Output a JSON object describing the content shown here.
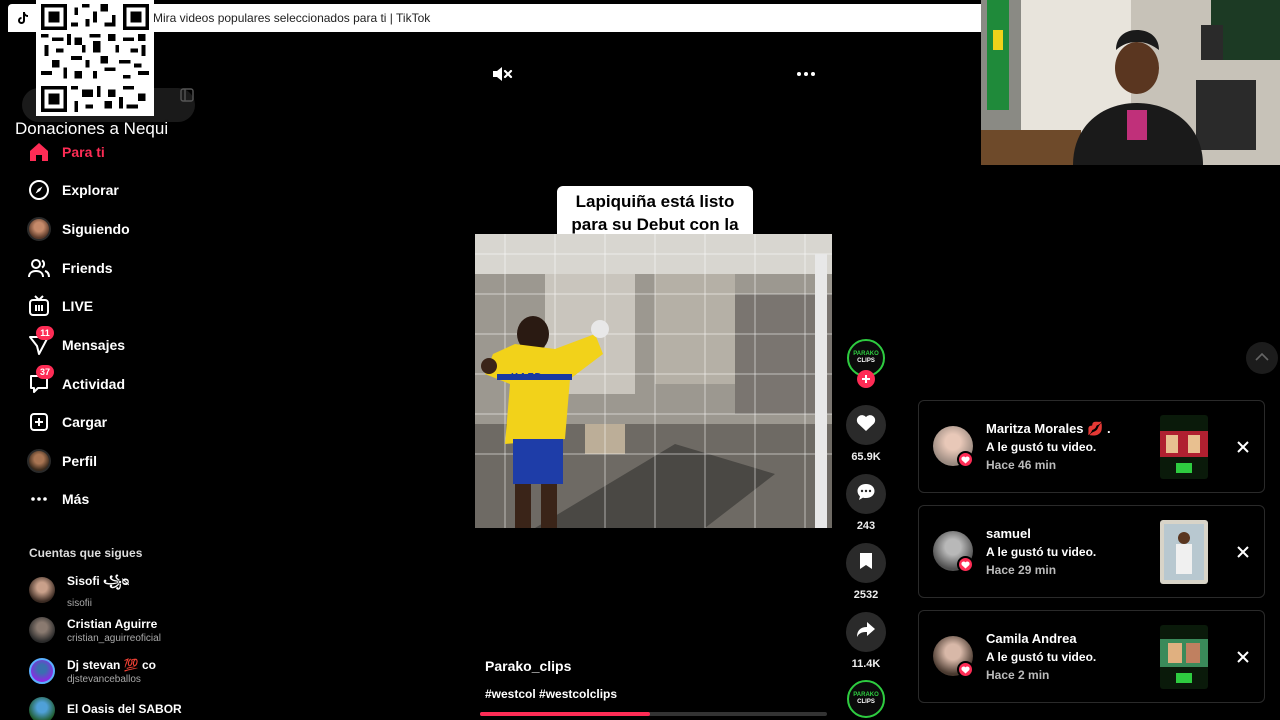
{
  "window": {
    "title": "Mira videos populares seleccionados para ti | TikTok"
  },
  "overlay": {
    "qr_caption": "Donaciones a Nequi"
  },
  "sidebar": {
    "items": [
      {
        "label": "Para ti",
        "icon": "home-icon",
        "active": true
      },
      {
        "label": "Explorar",
        "icon": "compass-icon"
      },
      {
        "label": "Siguiendo",
        "icon": "following-avatar-icon"
      },
      {
        "label": "Friends",
        "icon": "friends-icon"
      },
      {
        "label": "LIVE",
        "icon": "live-icon"
      },
      {
        "label": "Mensajes",
        "icon": "messages-icon",
        "badge": "11"
      },
      {
        "label": "Actividad",
        "icon": "activity-icon",
        "badge": "37"
      },
      {
        "label": "Cargar",
        "icon": "upload-icon"
      },
      {
        "label": "Perfil",
        "icon": "profile-avatar-icon"
      },
      {
        "label": "Más",
        "icon": "more-dots-icon"
      }
    ],
    "following_heading": "Cuentas que sigues",
    "following": [
      {
        "name": "Sisofi ꧁ᴓ",
        "handle": "sisofii"
      },
      {
        "name": "Cristian Aguirre",
        "handle": "cristian_aguirreoficial"
      },
      {
        "name": "Dj stevan 💯 co",
        "handle": "djstevanceballos"
      },
      {
        "name": "El Oasis del SABOR",
        "handle": ""
      }
    ]
  },
  "video": {
    "caption": "Lapiquiña está listo para su Debut con la ganga😭",
    "author": "Parako_clips",
    "tags": "#westcol #westcolclips",
    "progress": 0.49,
    "creator_badge_top": "PARAKO",
    "creator_badge_bottom": "CLIPS",
    "jersey_text": "KAFD"
  },
  "actions": {
    "likes": "65.9K",
    "comments": "243",
    "saves": "2532",
    "shares": "11.4K"
  },
  "notifications": [
    {
      "name": "Maritza Morales 💋 .",
      "action": "A le gustó tu video.",
      "time": "Hace 46 min"
    },
    {
      "name": "samuel",
      "action": "A le gustó tu video.",
      "time": "Hace 29 min"
    },
    {
      "name": "Camila Andrea",
      "action": "A le gustó tu video.",
      "time": "Hace 2 min"
    }
  ],
  "colors": {
    "accent": "#fe2c55",
    "background": "#000000",
    "creator_ring": "#2ecc40"
  }
}
